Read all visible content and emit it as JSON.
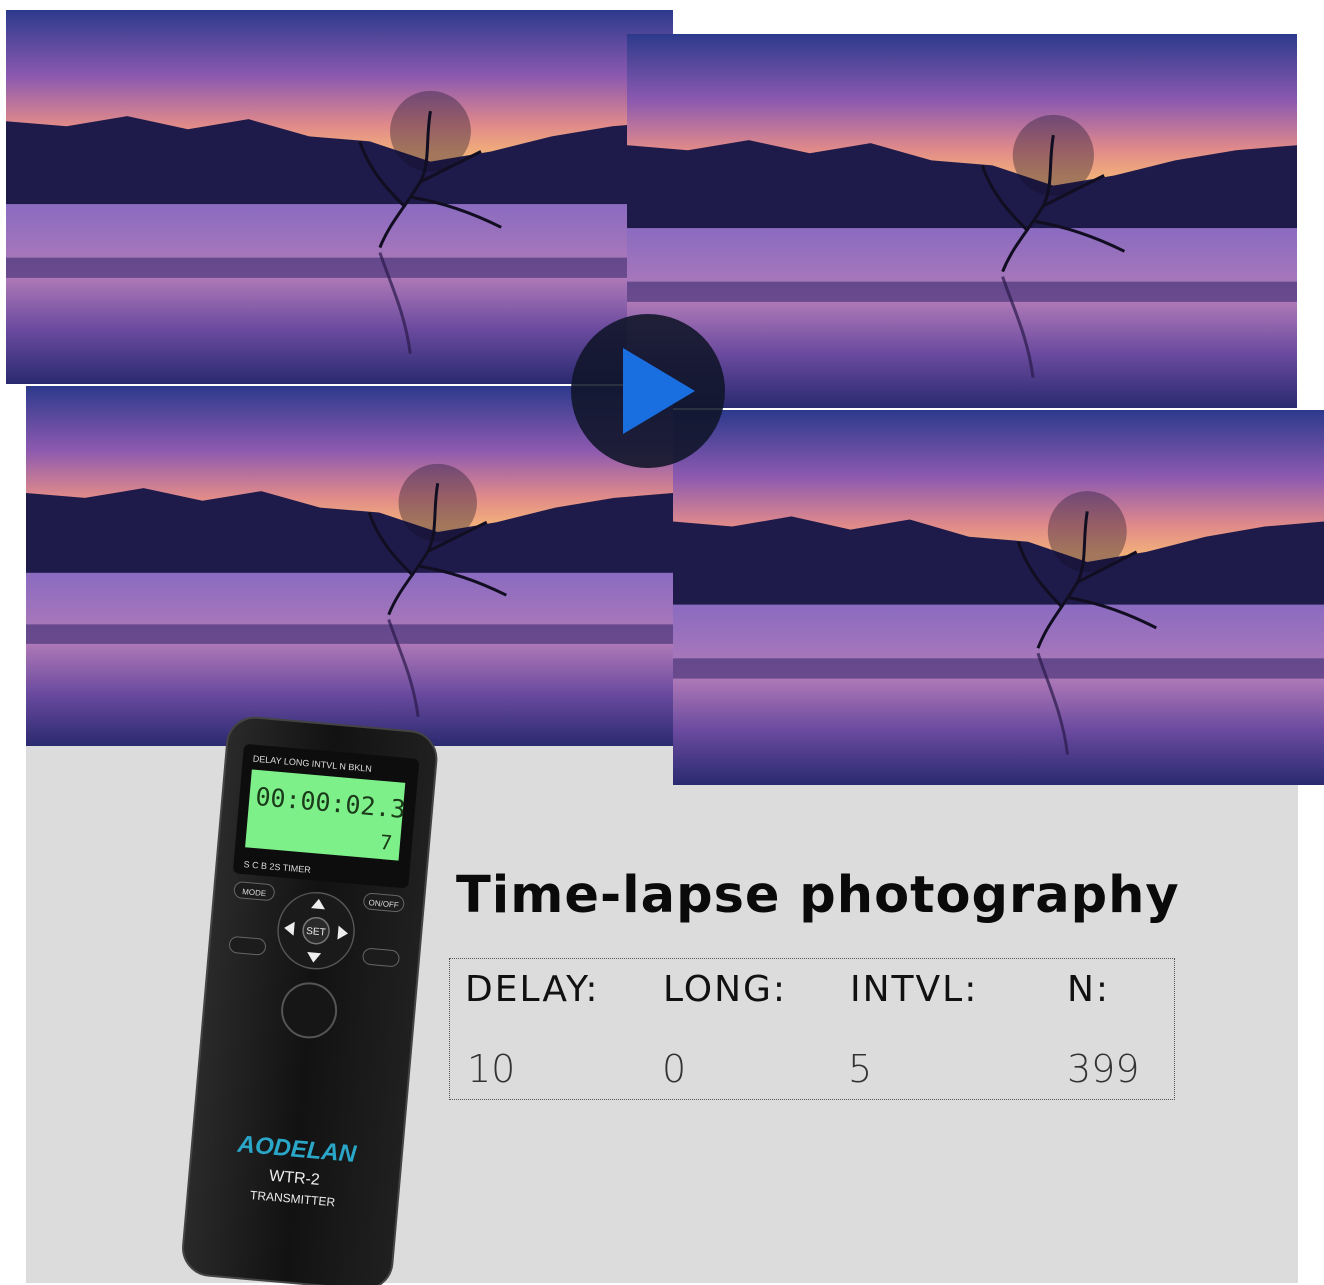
{
  "heading": "Time-lapse photography",
  "settings": [
    {
      "label": "DELAY:",
      "value": "10"
    },
    {
      "label": "LONG:",
      "value": "0"
    },
    {
      "label": "INTVL:",
      "value": "5"
    },
    {
      "label": "N:",
      "value": "399"
    }
  ],
  "remote": {
    "brand": "AODELAN",
    "model": "WTR-2",
    "type": "TRANSMITTER",
    "lcd_modes": [
      "DELAY",
      "LONG",
      "INTVL",
      "N",
      "BKLN"
    ],
    "lcd_time": "00:00:02.3",
    "lcd_count": "7",
    "bottom_modes": [
      "S",
      "C",
      "B",
      "2S",
      "TIMER"
    ],
    "btn_mode": "MODE",
    "btn_onoff": "ON/OFF",
    "btn_set": "SET"
  },
  "play_button_icon": "play-icon",
  "colors": {
    "brand": "#2aa6c8",
    "play": "#1a6fe0",
    "lcd": "#7ef08a"
  }
}
